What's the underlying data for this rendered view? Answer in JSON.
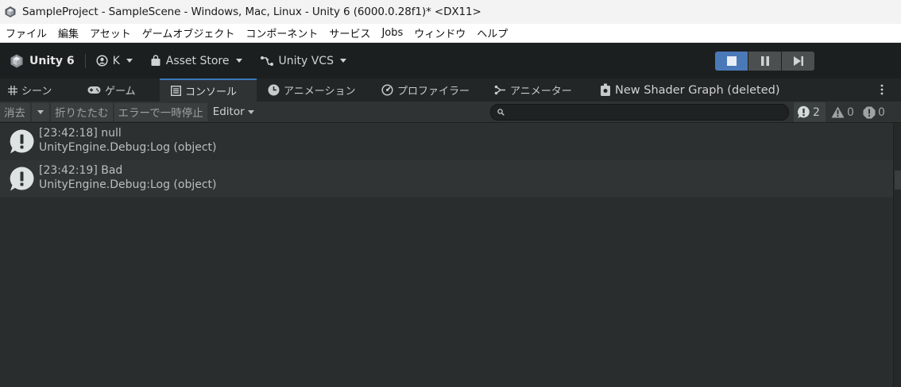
{
  "window": {
    "title": "SampleProject - SampleScene - Windows, Mac, Linux - Unity 6 (6000.0.28f1)* <DX11>"
  },
  "menu": [
    "ファイル",
    "編集",
    "アセット",
    "ゲームオブジェクト",
    "コンポーネント",
    "サービス",
    "Jobs",
    "ウィンドウ",
    "ヘルプ"
  ],
  "toolbar": {
    "unity_label": "Unity 6",
    "account_label": "K",
    "asset_store_label": "Asset Store",
    "vcs_label": "Unity VCS"
  },
  "tabs": [
    {
      "label": "シーン",
      "icon": "grid-icon"
    },
    {
      "label": "ゲーム",
      "icon": "gamepad-icon"
    },
    {
      "label": "コンソール",
      "icon": "console-icon",
      "active": true
    },
    {
      "label": "アニメーション",
      "icon": "clock-icon"
    },
    {
      "label": "プロファイラー",
      "icon": "gauge-icon"
    },
    {
      "label": "アニメーター",
      "icon": "animator-icon"
    },
    {
      "label": "New Shader Graph (deleted)",
      "icon": "shader-graph-icon"
    }
  ],
  "console": {
    "clear_label": "消去",
    "collapse_label": "折りたたむ",
    "error_pause_label": "エラーで一時停止",
    "editor_label": "Editor",
    "search_placeholder": "",
    "counts": {
      "info": "2",
      "warning": "0",
      "error": "0"
    }
  },
  "logs": [
    {
      "line1": "[23:42:18] null",
      "line2": "UnityEngine.Debug:Log (object)"
    },
    {
      "line1": "[23:42:19] Bad",
      "line2": "UnityEngine.Debug:Log (object)"
    }
  ],
  "colors": {
    "accent": "#3a79bb",
    "play_active": "#4a79b8",
    "background": "#282b2b"
  }
}
